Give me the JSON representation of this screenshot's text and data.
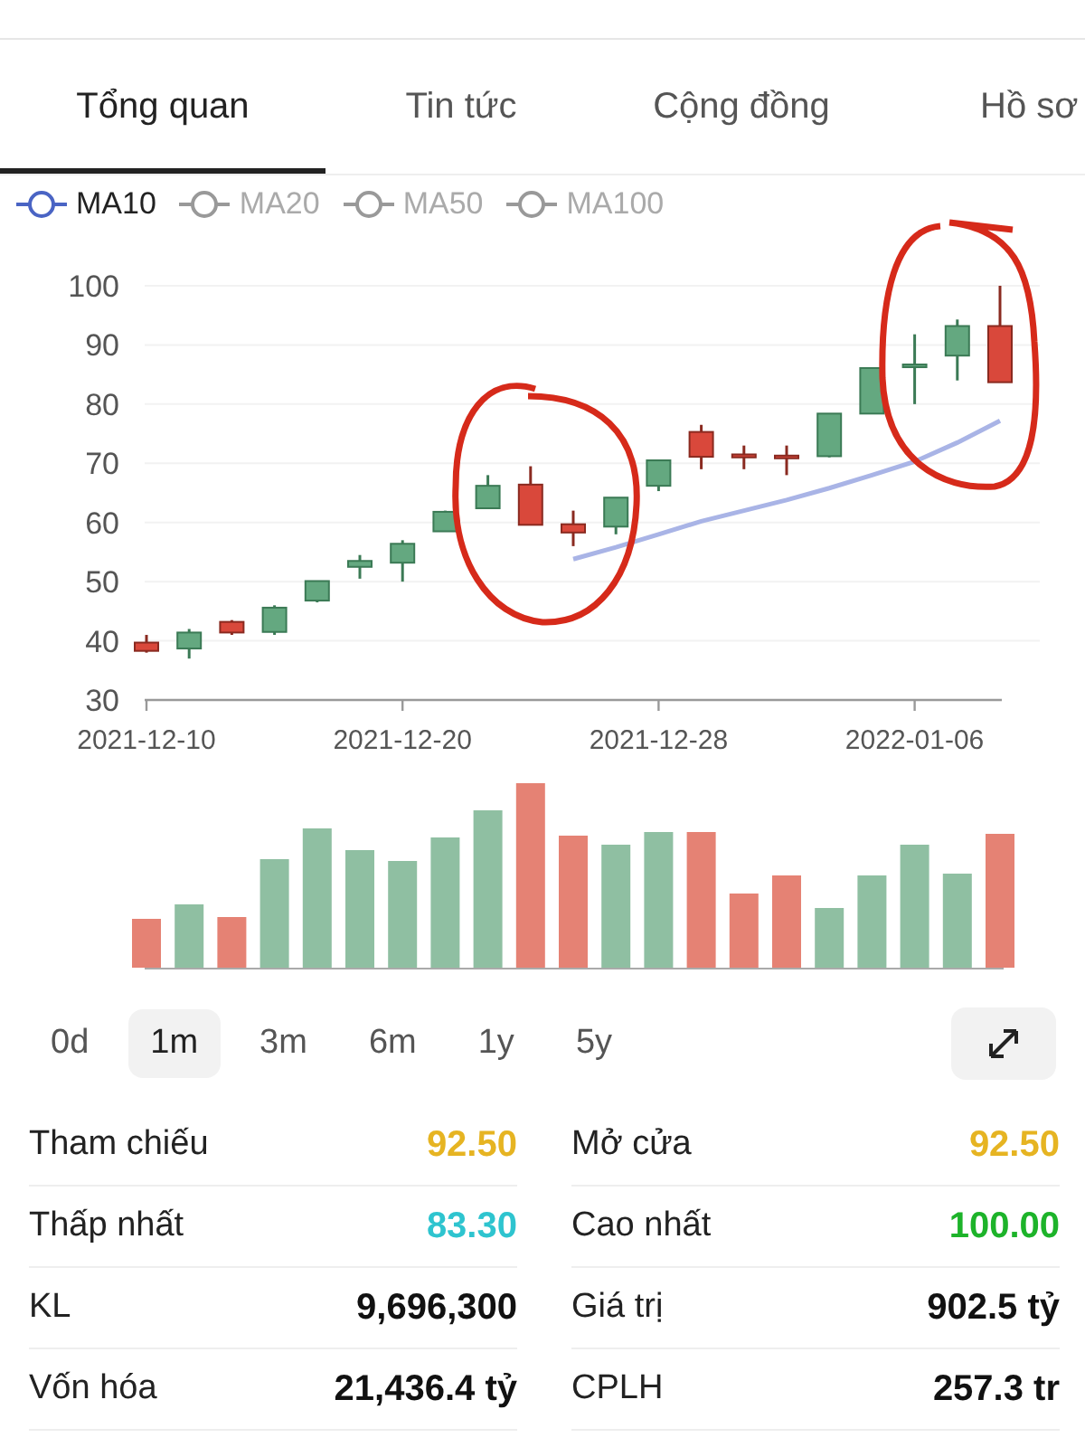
{
  "tabs": [
    {
      "label": "Tổng quan",
      "selected": true
    },
    {
      "label": "Tin tức",
      "selected": false
    },
    {
      "label": "Cộng đồng",
      "selected": false
    },
    {
      "label": "Hồ sơ",
      "selected": false
    }
  ],
  "legend": [
    {
      "selected": true
    },
    {
      "label": "MA20",
      "selected": false
    },
    {
      "label": "MA50",
      "selected": false
    },
    {
      "label": "MA100",
      "selected": false
    }
  ],
  "chart_data": {
    "type": "candlestick",
    "categories": [
      "2021-12-10",
      null,
      null,
      null,
      null,
      null,
      "2021-12-20",
      null,
      null,
      null,
      null,
      null,
      "2021-12-28",
      null,
      null,
      null,
      null,
      null,
      "2022-01-06",
      null,
      null
    ],
    "ylim": [
      30,
      100
    ],
    "grid": true,
    "yticks": [
      30,
      40,
      50,
      60,
      70,
      80,
      90,
      100
    ],
    "ohlc": [
      [
        39.7,
        41,
        38,
        38.3
      ],
      [
        38.7,
        42,
        37,
        41.4
      ],
      [
        43.2,
        43.5,
        41,
        41.4
      ],
      [
        41.5,
        46,
        41,
        45.6
      ],
      [
        46.8,
        50.1,
        46.5,
        50.1
      ],
      [
        52.5,
        54.5,
        50.5,
        53.5
      ],
      [
        53.2,
        57,
        50,
        56.4
      ],
      [
        58.5,
        62,
        58.5,
        61.8
      ],
      [
        62.4,
        68,
        62.4,
        66.2
      ],
      [
        66.4,
        69.5,
        59.6,
        59.6
      ],
      [
        59.7,
        62,
        56,
        58.3
      ],
      [
        59.3,
        64.2,
        58,
        64.2
      ],
      [
        66.2,
        70.5,
        65.3,
        70.5
      ],
      [
        75.3,
        76.5,
        69,
        71.1
      ],
      [
        71.5,
        73,
        69,
        71
      ],
      [
        71.3,
        73,
        68,
        71
      ],
      [
        71.2,
        78.4,
        71,
        78.4
      ],
      [
        78.4,
        86.1,
        78.4,
        86.1
      ],
      [
        86.5,
        91.8,
        80,
        86.7
      ],
      [
        88.2,
        94.3,
        84,
        93.2
      ],
      [
        93.2,
        100,
        83.7,
        83.7
      ]
    ],
    "series": [
      {
        "name": "MA10",
        "type": "line",
        "color": "#a9b4e6",
        "values": [
          null,
          null,
          null,
          null,
          null,
          null,
          null,
          null,
          null,
          null,
          53.8,
          55.8,
          58,
          60.2,
          62,
          63.8,
          65.8,
          68,
          70.3,
          73.5,
          77.2
        ]
      }
    ]
  },
  "ranges": [
    {
      "label": "0d",
      "selected": false
    },
    {
      "label": "1m",
      "selected": true
    },
    {
      "label": "3m",
      "selected": false
    },
    {
      "label": "6m",
      "selected": false
    },
    {
      "label": "1y",
      "selected": false
    },
    {
      "label": "5y",
      "selected": false
    }
  ],
  "stats": [
    {
      "label": "Tham chiếu",
      "value": "92.50",
      "color": "#e6b422"
    },
    {
      "label": "Mở cửa",
      "value": "92.50",
      "color": "#e6b422"
    },
    {
      "label": "Thấp nhất",
      "value": "83.30",
      "color": "#2ec4cf"
    },
    {
      "label": "Cao nhất",
      "value": "100.00",
      "color": "#1db32a"
    },
    {
      "label": "KL",
      "value": "9,696,300",
      "color": "#111111"
    },
    {
      "label": "Giá trị",
      "value": "902.5 tỷ",
      "color": "#111111"
    },
    {
      "label": "Vốn hóa",
      "value": "21,436.4 tỷ",
      "color": "#111111"
    },
    {
      "label": "CPLH",
      "value": "257.3 tr",
      "color": "#111111"
    }
  ]
}
